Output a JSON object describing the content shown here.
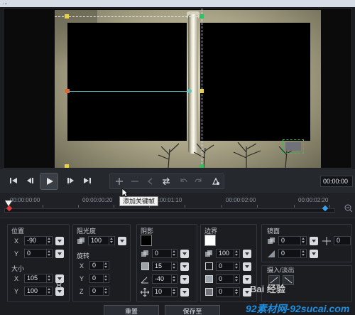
{
  "window": {
    "title": "..."
  },
  "transport": {
    "timecode": "00:00:00",
    "buttons": [
      "go-to-start",
      "previous-frame",
      "play",
      "next-frame",
      "go-to-end"
    ],
    "keyframe_tools": [
      "add-keyframe",
      "remove-keyframe",
      "previous-keyframe",
      "reverse",
      "undo",
      "redo",
      "reset-keyframe"
    ]
  },
  "tooltip": {
    "text": "添加关键帧"
  },
  "ruler": {
    "times": [
      "00:00:00:00",
      "00:00:00:20",
      "00:00:01:10",
      "00:00:02:00",
      "00:00:02:20"
    ]
  },
  "panel": {
    "position": {
      "label": "位置",
      "x": "-90",
      "y": "0"
    },
    "size": {
      "label": "大小",
      "x": "105",
      "y": "100"
    },
    "opacity": {
      "label": "阻光度",
      "value": "100"
    },
    "rotation": {
      "label": "旋转",
      "x": "0",
      "y": "0",
      "z": "0"
    },
    "shadow": {
      "label": "阴影",
      "color": "#000000",
      "v1": "0",
      "v2": "15",
      "angle": "-40",
      "distance": "10"
    },
    "border": {
      "label": "边界",
      "color": "#ffffff",
      "v1": "100",
      "v2": "0",
      "v3": "0",
      "v4": "0"
    },
    "mirror": {
      "label": "镜面",
      "v1": "0",
      "v2": "0"
    },
    "fade": {
      "label": "摄入/淡出"
    },
    "buttons": {
      "reset": "重置",
      "save_as": "保存至"
    }
  },
  "watermark": {
    "line1": "Bai 经验",
    "line2": "92素材网-92sucai.com"
  },
  "colors": {
    "accent_teal": "#5dc1bb",
    "handle_yellow": "#e8d24a",
    "handle_orange": "#e0662c",
    "keyframe_red": "#e03a3a",
    "keyframe_blue": "#3aa0e8"
  }
}
